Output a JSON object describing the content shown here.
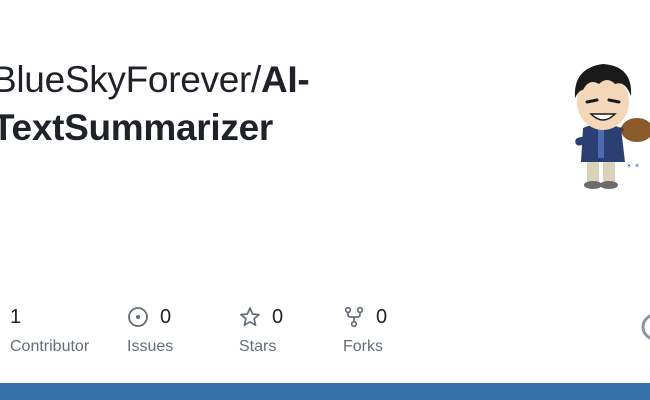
{
  "repo": {
    "owner": "BlueSkyForever",
    "separator": "/",
    "name_part1": "AI-",
    "name_part2": "TextSummarizer"
  },
  "avatar": {
    "description_icon": "avatar-cartoon-guitarist"
  },
  "stats": {
    "contributors": {
      "count": "1",
      "label": "Contributor"
    },
    "issues": {
      "count": "0",
      "label": "Issues",
      "icon": "issue-opened-icon"
    },
    "stars": {
      "count": "0",
      "label": "Stars",
      "icon": "star-icon"
    },
    "forks": {
      "count": "0",
      "label": "Forks",
      "icon": "repo-forked-icon"
    }
  },
  "colors": {
    "bottom_bar": "#3570a8",
    "text_primary": "#1f2328",
    "text_muted": "#656d76"
  }
}
